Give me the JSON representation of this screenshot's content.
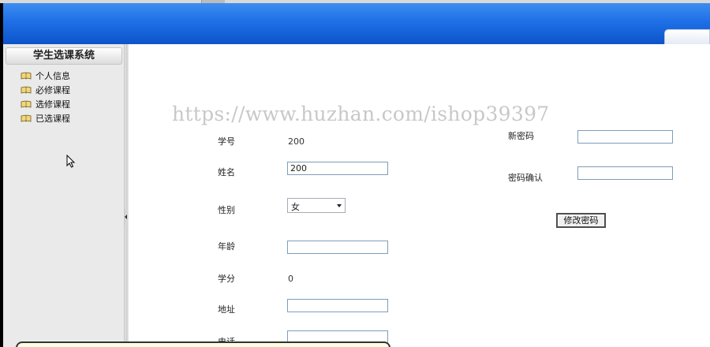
{
  "sidebar": {
    "title": "学生选课系统",
    "items": [
      {
        "label": "个人信息",
        "icon": "book-icon"
      },
      {
        "label": "必修课程",
        "icon": "book-icon"
      },
      {
        "label": "选修课程",
        "icon": "book-icon"
      },
      {
        "label": "已选课程",
        "icon": "book-icon"
      }
    ]
  },
  "watermark": "https://www.huzhan.com/ishop39397",
  "form": {
    "student_id": {
      "label": "学号",
      "value": "200"
    },
    "name": {
      "label": "姓名",
      "value": "200"
    },
    "gender": {
      "label": "性别",
      "value": "女"
    },
    "age": {
      "label": "年龄",
      "value": ""
    },
    "credits": {
      "label": "学分",
      "value": "0"
    },
    "address": {
      "label": "地址",
      "value": ""
    },
    "phone": {
      "label": "电话",
      "value": ""
    }
  },
  "password": {
    "new_label": "新密码",
    "new_value": "",
    "confirm_label": "密码确认",
    "confirm_value": "",
    "submit_label": "修改密码"
  },
  "colors": {
    "banner_top": "#3d8df0",
    "banner_bottom": "#0d54c9",
    "sidebar_bg": "#eaeaea",
    "input_border": "#7f9db9"
  }
}
